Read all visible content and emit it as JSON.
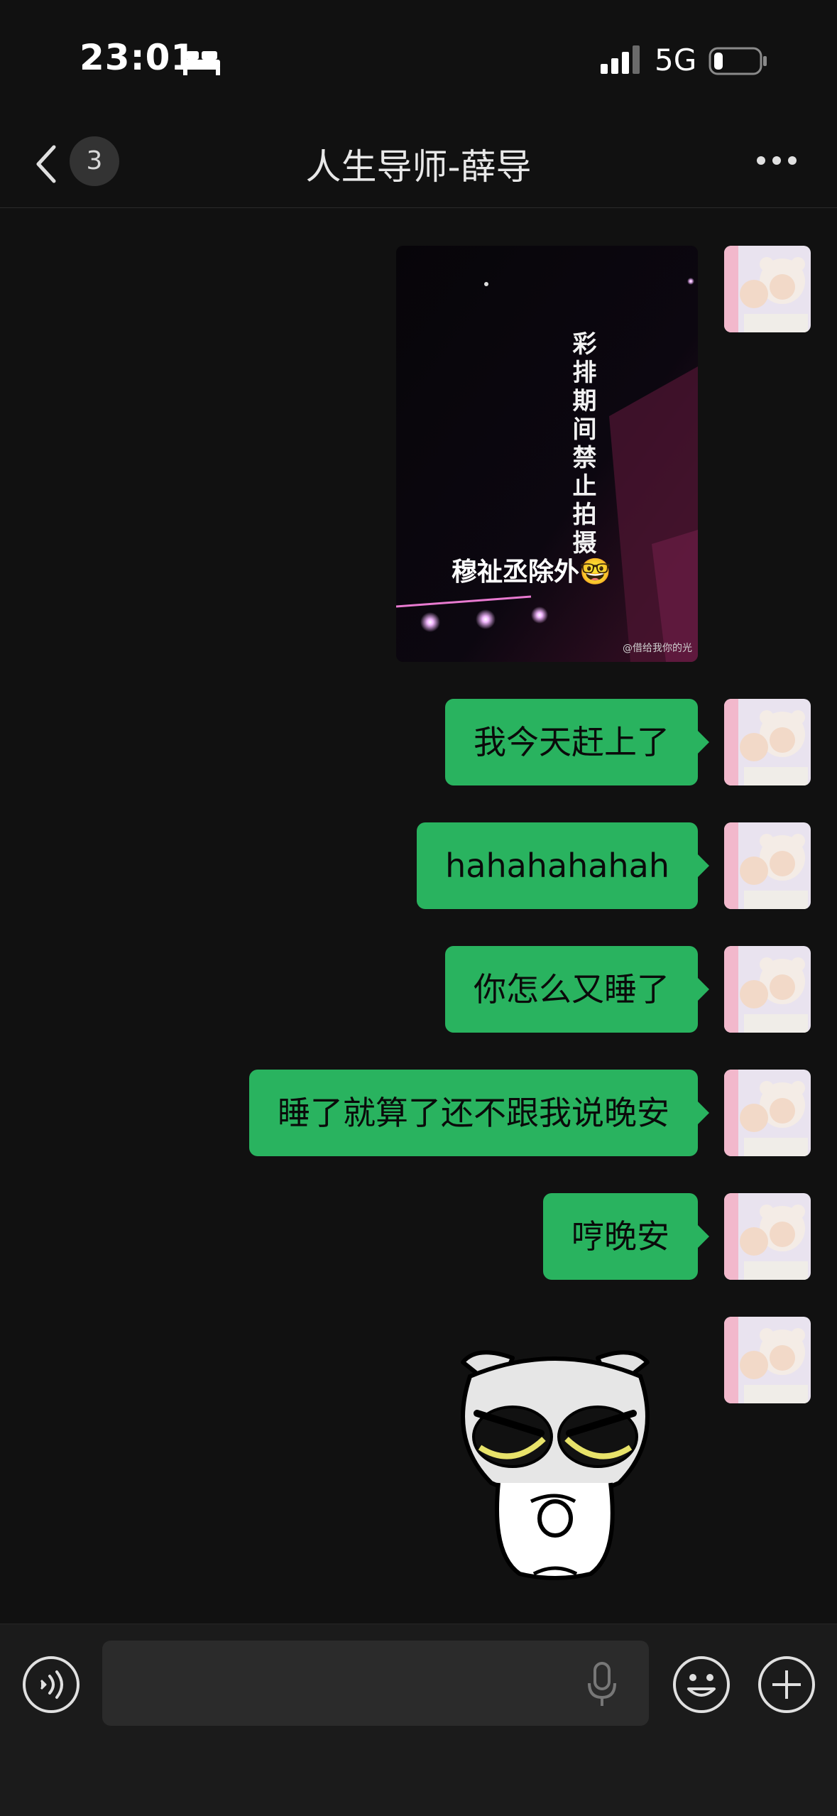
{
  "status_bar": {
    "time": "23:01",
    "network": "5G"
  },
  "nav": {
    "unread_count": "3",
    "title": "人生导师-薛导"
  },
  "image_message": {
    "vertical_text": "彩排期间禁止拍摄",
    "caption": "穆祉丞除外🤓",
    "watermark": "@借给我你的光"
  },
  "messages": [
    {
      "text": "我今天赶上了"
    },
    {
      "text": "hahahahahah"
    },
    {
      "text": "你怎么又睡了"
    },
    {
      "text": "睡了就算了还不跟我说晚安"
    },
    {
      "text": "哼晚安"
    }
  ],
  "input_bar": {
    "message_value": ""
  },
  "colors": {
    "bubble": "#29b35f",
    "background": "#111111"
  }
}
